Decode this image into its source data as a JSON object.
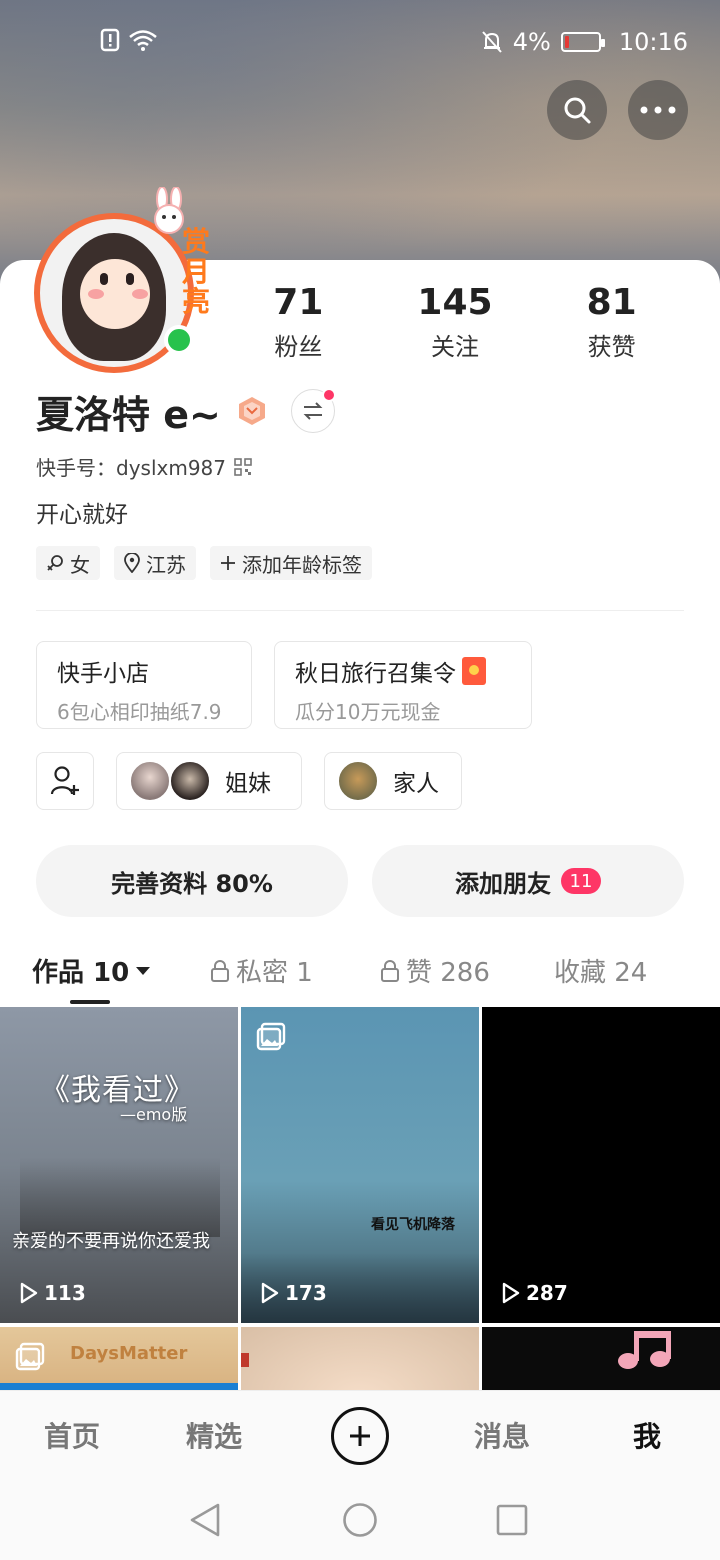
{
  "status_bar": {
    "battery_percent": "4%",
    "time": "10:16"
  },
  "profile": {
    "avatar_badge_text": "赏月亮",
    "name": "夏洛特 e~",
    "kwai_id": "快手号：dyslxm987",
    "bio": "开心就好"
  },
  "stats": [
    {
      "value": "71",
      "label": "粉丝"
    },
    {
      "value": "145",
      "label": "关注"
    },
    {
      "value": "81",
      "label": "获赞"
    }
  ],
  "tags": {
    "gender": "女",
    "location": "江苏",
    "add_age": "添加年龄标签"
  },
  "cards": [
    {
      "title": "快手小店",
      "subtitle": "6包心相印抽纸7.9"
    },
    {
      "title": "秋日旅行召集令",
      "subtitle": "瓜分10万元现金"
    }
  ],
  "groups": [
    {
      "label": "姐妹"
    },
    {
      "label": "家人"
    }
  ],
  "actions": {
    "complete_profile": "完善资料 80%",
    "add_friends": "添加朋友",
    "add_friends_badge": "11"
  },
  "tabs": {
    "works": "作品 10",
    "private": "私密 1",
    "likes": "赞 286",
    "favorites": "收藏 24"
  },
  "grid": [
    {
      "title": "《我看过》",
      "subtitle": "—emo版",
      "caption": "亲爱的不要再说你还爱我",
      "views": "113"
    },
    {
      "caption": "看见飞机降落",
      "views": "173"
    },
    {
      "views": "287"
    },
    {
      "caption": "DaysMatter"
    }
  ],
  "bottom_nav": {
    "home": "首页",
    "featured": "精选",
    "messages": "消息",
    "me": "我"
  },
  "colors": {
    "accent_red": "#fe3666",
    "online_green": "#27c24c",
    "avatar_ring": "#f36b3c"
  },
  "icons": [
    "silent-mode-icon",
    "wifi-icon",
    "bell-off-icon",
    "battery-icon",
    "search-icon",
    "more-icon",
    "level-badge-icon",
    "switch-account-icon",
    "qr-code-icon",
    "gender-icon",
    "location-icon",
    "plus-icon",
    "red-packet-icon",
    "add-friend-icon",
    "lock-icon",
    "play-icon",
    "multi-image-icon",
    "create-icon",
    "back-icon",
    "home-circle-icon",
    "recents-icon"
  ]
}
